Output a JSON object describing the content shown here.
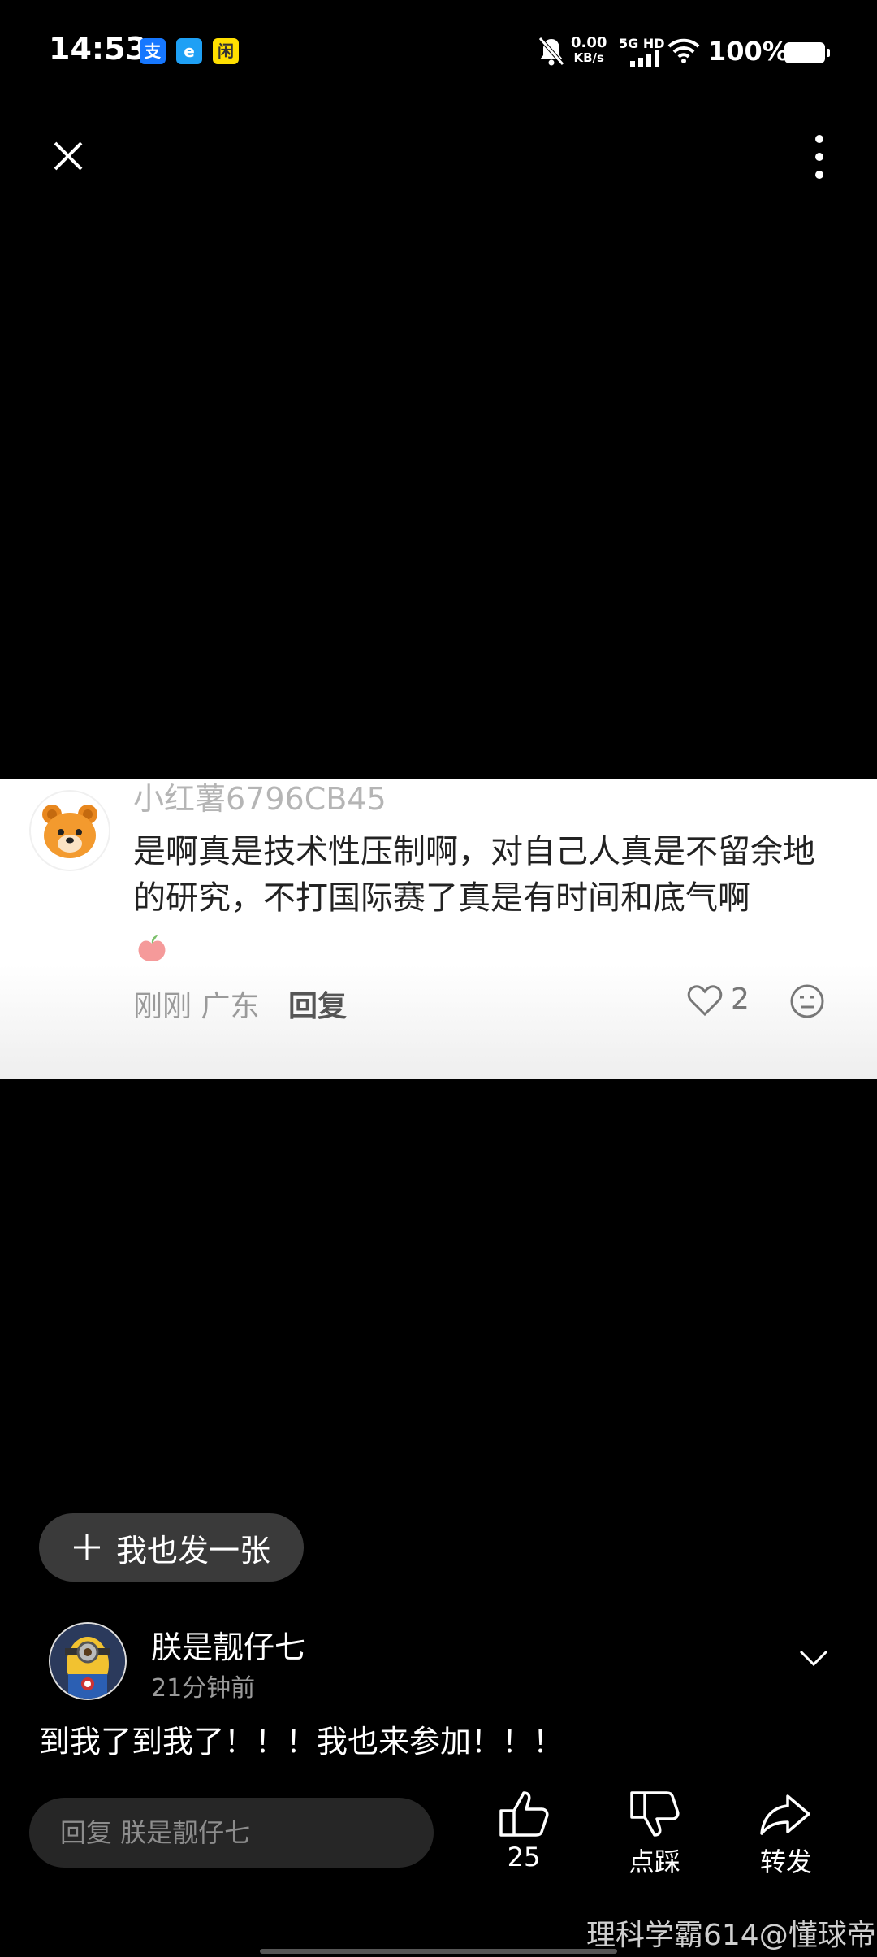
{
  "status_bar": {
    "time": "14:53",
    "net_speed_value": "0.00",
    "net_speed_unit": "KB/s",
    "signal_label": "5G HD",
    "battery_percent": "100%",
    "app_badges": [
      {
        "label": "支",
        "color": "#1677ff"
      },
      {
        "label": "e",
        "color": "#1ea0f5"
      },
      {
        "label": "闲",
        "color": "#ffdf00"
      }
    ]
  },
  "top_bar": {
    "close_icon": "close-icon",
    "more_icon": "more-vertical-icon"
  },
  "comment_card": {
    "username": "小红薯6796CB45",
    "text": "是啊真是技术性压制啊，对自己人真是不留余地的研究，不打国际赛了真是有时间和底气啊",
    "time_location": "刚刚 广东",
    "reply_label": "回复",
    "like_count": "2"
  },
  "publish_button": {
    "label": "我也发一张"
  },
  "post": {
    "author": "朕是靓仔七",
    "time": "21分钟前",
    "text": "到我了到我了！！！我也来参加！！！"
  },
  "bottom_bar": {
    "reply_placeholder": "回复 朕是靓仔七",
    "like_count": "25",
    "dislike_label": "点踩",
    "share_label": "转发"
  },
  "watermark": "理科学霸614@懂球帝"
}
